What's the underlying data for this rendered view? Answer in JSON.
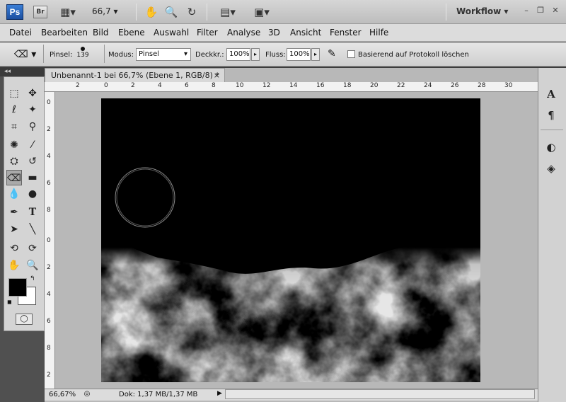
{
  "appbar": {
    "app_logo": "Ps",
    "bridge_logo": "Br",
    "zoom_value": "66,7",
    "workspace_label": "Workflow",
    "icons": [
      "film-icon",
      "hand-icon",
      "zoom-icon",
      "rotate-view-icon",
      "arrange-documents-icon",
      "screen-mode-icon"
    ]
  },
  "menu": {
    "items": [
      "Datei",
      "Bearbeiten",
      "Bild",
      "Ebene",
      "Auswahl",
      "Filter",
      "Analyse",
      "3D",
      "Ansicht",
      "Fenster",
      "Hilfe"
    ]
  },
  "options": {
    "brush_label": "Pinsel:",
    "brush_size": "139",
    "mode_label": "Modus:",
    "mode_value": "Pinsel",
    "opacity_label": "Deckkr.:",
    "opacity_value": "100%",
    "flow_label": "Fluss:",
    "flow_value": "100%",
    "erase_history_label": "Basierend auf Protokoll löschen"
  },
  "document": {
    "tab_title": "Unbenannt-1 bei 66,7% (Ebene 1, RGB/8) *",
    "close_glyph": "×",
    "ruler_h_labels": [
      "2",
      "0",
      "2",
      "4",
      "6",
      "8",
      "10",
      "12",
      "14",
      "16",
      "18",
      "20",
      "22",
      "24",
      "26",
      "28",
      "30"
    ],
    "ruler_v_labels": [
      "0",
      "2",
      "4",
      "6",
      "8",
      "0",
      "2",
      "4",
      "6",
      "8",
      "2"
    ]
  },
  "status": {
    "zoom": "66,67%",
    "doc_info": "Dok: 1,37 MB/1,37 MB"
  },
  "colors": {
    "foreground": "#000000",
    "background": "#ffffff",
    "app_chrome": "#d6d6d6",
    "dark_panel": "#505050"
  }
}
